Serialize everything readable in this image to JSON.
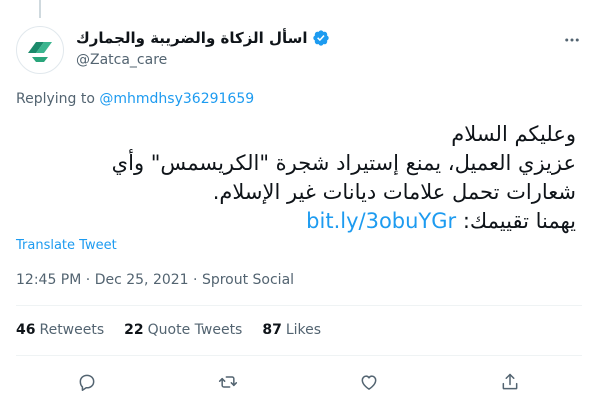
{
  "account": {
    "display_name": "اسأل الزكاة والضريبة والجمارك",
    "handle": "@Zatca_care"
  },
  "reply": {
    "prefix": "Replying to",
    "mention": "@mhmdhsy36291659"
  },
  "tweet": {
    "lines": [
      "وعليكم السلام",
      "عزيزي العميل، يمنع إستيراد شجرة \"الكريسمس\" وأي",
      "شعارات تحمل علامات ديانات غير الإسلام."
    ],
    "link_prefix": "يهمنا تقييمك:",
    "link": "bit.ly/3obuYGr"
  },
  "translate_label": "Translate Tweet",
  "meta": {
    "time": "12:45 PM",
    "separator1": "·",
    "date": "Dec 25, 2021",
    "separator2": "·",
    "source": "Sprout Social"
  },
  "stats": {
    "retweets_count": "46",
    "retweets_label": "Retweets",
    "quotes_count": "22",
    "quotes_label": "Quote Tweets",
    "likes_count": "87",
    "likes_label": "Likes"
  },
  "colors": {
    "accent": "#1d9bf0",
    "text": "#0f1419",
    "secondary": "#536471",
    "logo_green": "#1b8a6b"
  },
  "icons": [
    "verified-badge-icon",
    "more-icon",
    "reply-icon",
    "retweet-icon",
    "like-icon",
    "share-icon",
    "zatca-logo"
  ]
}
